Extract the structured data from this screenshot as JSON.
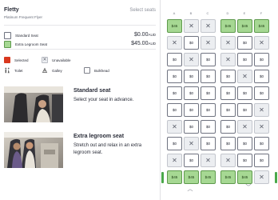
{
  "passenger": {
    "name": "Fletty",
    "tier": "Platinum Frequent Flyer",
    "select_label": "Select seats"
  },
  "prices": [
    {
      "label": "Standard Seat",
      "amount": "$0.00",
      "currency": "AUD",
      "color": "#ffffff"
    },
    {
      "label": "Extra Legroom Seat",
      "amount": "$45.00",
      "currency": "AUD",
      "color": "#a6d893"
    }
  ],
  "legend": [
    {
      "label": "Selected",
      "icon": "selected-swatch-icon"
    },
    {
      "label": "Unavailable",
      "icon": "unavailable-x-icon"
    },
    {
      "label": "Toilet",
      "icon": "toilet-icon"
    },
    {
      "label": "Galley",
      "icon": "galley-icon"
    },
    {
      "label": "Bulkhead",
      "icon": "bulkhead-icon"
    }
  ],
  "promos": [
    {
      "title": "Standard seat",
      "desc": "Select your seat in advance."
    },
    {
      "title": "Extra legroom seat",
      "desc": "Stretch out and relax in an extra legroom seat."
    }
  ],
  "seat_map": {
    "columns": [
      "A",
      "B",
      "C",
      "D",
      "E",
      "F"
    ],
    "rows": [
      [
        "$45",
        "X",
        "X",
        "$45",
        "$45",
        "$45"
      ],
      [
        "X",
        "$0",
        "X",
        "X",
        "$0",
        "X"
      ],
      [
        "$0",
        "X",
        "$0",
        "X",
        "$0",
        "$0"
      ],
      [
        "$0",
        "$0",
        "$0",
        "$0",
        "X",
        "$0"
      ],
      [
        "$0",
        "$0",
        "$0",
        "$0",
        "$0",
        "$0"
      ],
      [
        "$0",
        "$0",
        "$0",
        "$0",
        "$0",
        "X"
      ],
      [
        "X",
        "$0",
        "$0",
        "$0",
        "X",
        "X"
      ],
      [
        "$0",
        "X",
        "$0",
        "$0",
        "$0",
        "$0"
      ],
      [
        "X",
        "$0",
        "X",
        "X",
        "$0",
        "$0"
      ],
      [
        "$45",
        "$45",
        "$45",
        "$45",
        "$45",
        "X"
      ]
    ]
  },
  "colors": {
    "extra_legroom": "#a6d893",
    "selected": "#d9381e",
    "unavailable": "#eceef1"
  }
}
